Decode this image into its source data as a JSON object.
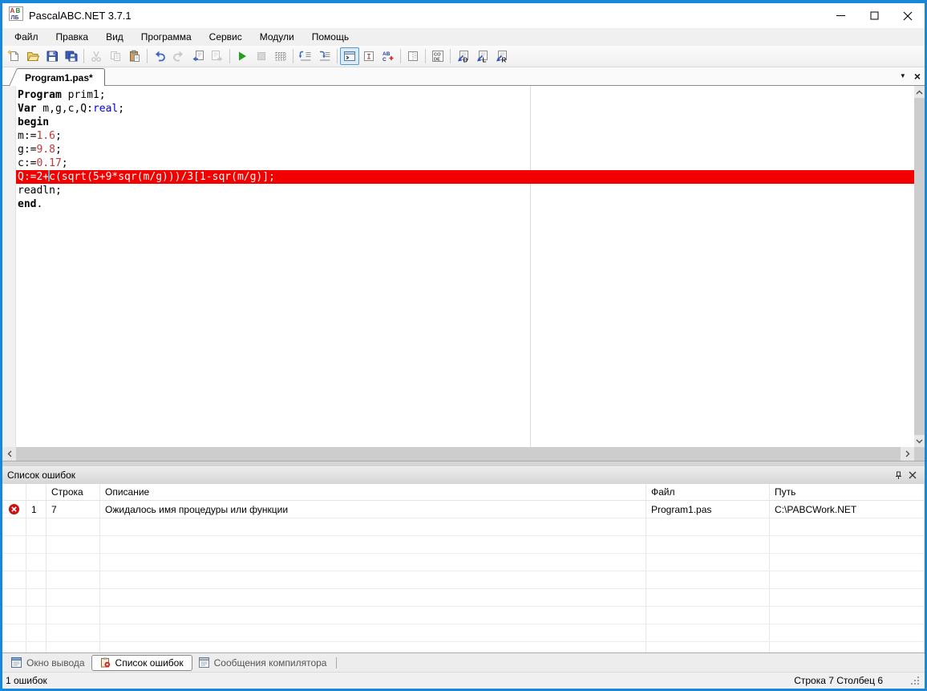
{
  "window": {
    "title": "PascalABC.NET 3.7.1"
  },
  "menu": {
    "items": [
      {
        "id": "file",
        "label": "Файл"
      },
      {
        "id": "edit",
        "label": "Правка"
      },
      {
        "id": "view",
        "label": "Вид"
      },
      {
        "id": "program",
        "label": "Программа"
      },
      {
        "id": "service",
        "label": "Сервис"
      },
      {
        "id": "modules",
        "label": "Модули"
      },
      {
        "id": "help",
        "label": "Помощь"
      }
    ]
  },
  "toolbar": {
    "buttons": [
      {
        "name": "new-file"
      },
      {
        "name": "open-file"
      },
      {
        "name": "save-file"
      },
      {
        "name": "save-all"
      },
      {
        "sep": true
      },
      {
        "name": "cut",
        "disabled": true
      },
      {
        "name": "copy",
        "disabled": true
      },
      {
        "name": "paste"
      },
      {
        "sep": true
      },
      {
        "name": "undo"
      },
      {
        "name": "redo",
        "disabled": true
      },
      {
        "name": "goto-prev"
      },
      {
        "name": "goto-next",
        "disabled": true
      },
      {
        "sep": true
      },
      {
        "name": "run"
      },
      {
        "name": "stop",
        "disabled": true
      },
      {
        "name": "compile"
      },
      {
        "sep": true
      },
      {
        "name": "outdent"
      },
      {
        "name": "indent"
      },
      {
        "sep": true
      },
      {
        "name": "show-output",
        "selected": true
      },
      {
        "name": "text-window"
      },
      {
        "name": "abc-net"
      },
      {
        "sep": true
      },
      {
        "name": "frames"
      },
      {
        "sep": true
      },
      {
        "name": "code-template"
      },
      {
        "sep": true
      },
      {
        "name": "net-decompile-d"
      },
      {
        "name": "net-decompile-l"
      },
      {
        "name": "net-decompile-r"
      }
    ]
  },
  "tabstrip": {
    "tabs": [
      {
        "label": "Program1.pas*",
        "active": true
      }
    ]
  },
  "editor": {
    "margin_column": 80,
    "lines": [
      {
        "tokens": [
          {
            "t": "Program",
            "c": "kw"
          },
          {
            "t": " prim1;",
            "c": "pl"
          }
        ]
      },
      {
        "tokens": [
          {
            "t": "Var",
            "c": "kw"
          },
          {
            "t": " m,g,c,Q:",
            "c": "pl"
          },
          {
            "t": "real",
            "c": "ty"
          },
          {
            "t": ";",
            "c": "pl"
          }
        ]
      },
      {
        "tokens": [
          {
            "t": "begin",
            "c": "kw"
          }
        ]
      },
      {
        "tokens": [
          {
            "t": "m:=",
            "c": "pl"
          },
          {
            "t": "1.6",
            "c": "num"
          },
          {
            "t": ";",
            "c": "pl"
          }
        ]
      },
      {
        "tokens": [
          {
            "t": "g:=",
            "c": "pl"
          },
          {
            "t": "9.8",
            "c": "num"
          },
          {
            "t": ";",
            "c": "pl"
          }
        ]
      },
      {
        "tokens": [
          {
            "t": "c:=",
            "c": "pl"
          },
          {
            "t": "0.17",
            "c": "num"
          },
          {
            "t": ";",
            "c": "pl"
          }
        ]
      },
      {
        "error": true,
        "tokens": [
          {
            "t": "Q:=2+",
            "c": "err"
          },
          {
            "caret": true
          },
          {
            "t": "c(sqrt(5+9*sqr(m/g)))/3[1-sqr(m/g)];",
            "c": "err"
          }
        ]
      },
      {
        "tokens": [
          {
            "t": "readln;",
            "c": "pl"
          }
        ]
      },
      {
        "tokens": [
          {
            "t": "end",
            "c": "kw"
          },
          {
            "t": ".",
            "c": "pl"
          }
        ]
      }
    ]
  },
  "error_panel": {
    "title": "Список ошибок",
    "columns": [
      {
        "id": "icon",
        "label": ""
      },
      {
        "id": "index",
        "label": ""
      },
      {
        "id": "line",
        "label": "Строка"
      },
      {
        "id": "description",
        "label": "Описание"
      },
      {
        "id": "file",
        "label": "Файл"
      },
      {
        "id": "path",
        "label": "Путь"
      }
    ],
    "rows": [
      {
        "icon": "error",
        "index": "1",
        "line": "7",
        "description": "Ожидалось имя процедуры или функции",
        "file": "Program1.pas",
        "path": "C:\\PABCWork.NET"
      }
    ]
  },
  "bottom_tabs": [
    {
      "id": "output-window",
      "label": "Окно вывода",
      "icon": "output-window-icon",
      "active": false
    },
    {
      "id": "error-list",
      "label": "Список ошибок",
      "icon": "error-list-icon",
      "active": true
    },
    {
      "id": "compiler-messages",
      "label": "Сообщения компилятора",
      "icon": "compiler-messages-icon",
      "active": false
    }
  ],
  "status_bar": {
    "errors": "1 ошибок",
    "position": "Строка 7 Столбец 6"
  },
  "colors": {
    "window_border": "#1886D9",
    "error_line_bg": "#F20000",
    "error_line_text": "#FFFFFF",
    "keyword": "#000000",
    "type_name": "#0000E0",
    "number": "#C03838",
    "error_icon": "#CC1111"
  }
}
